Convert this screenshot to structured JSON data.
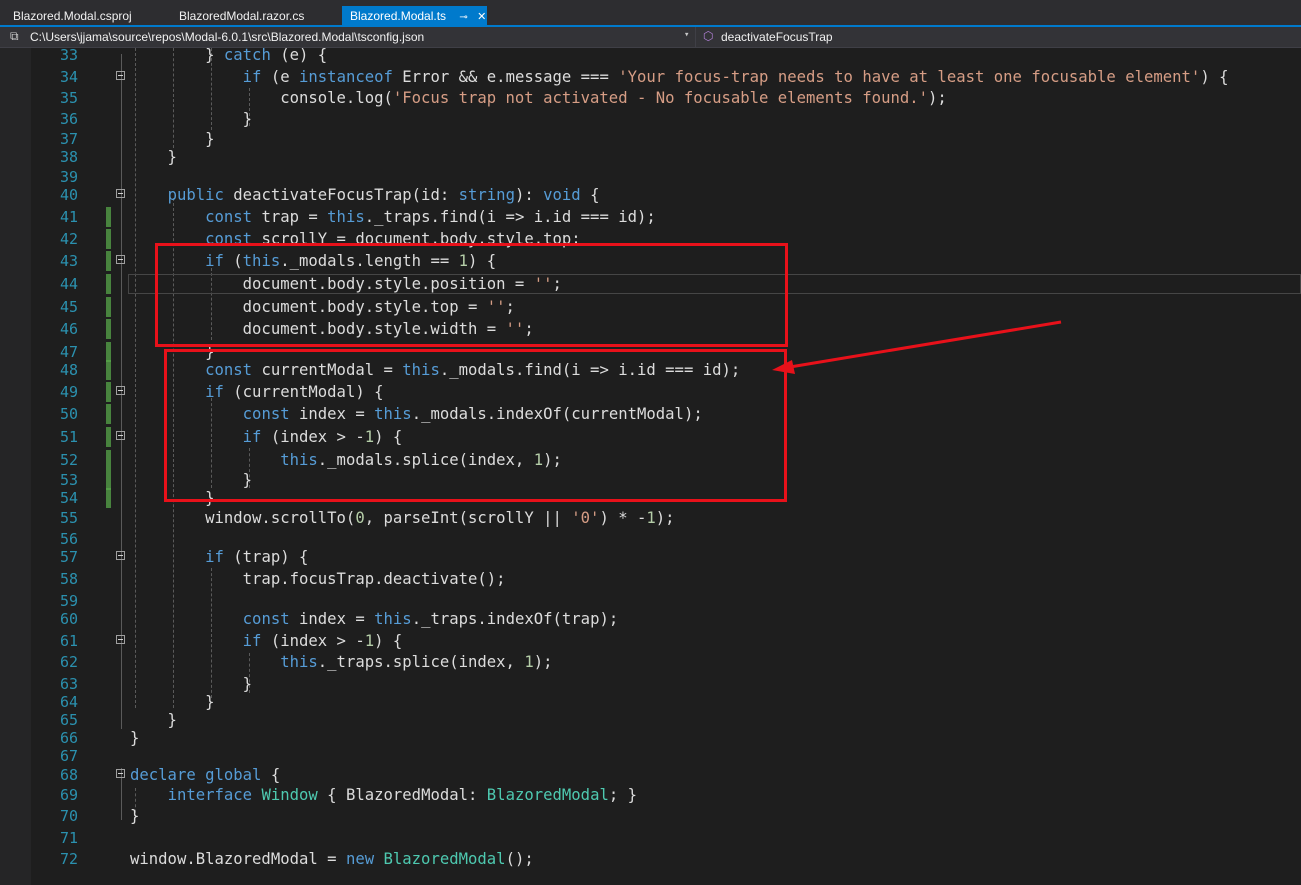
{
  "tabs": [
    {
      "label": "Blazored.Modal.csproj"
    },
    {
      "label": "BlazoredModal.razor.cs"
    },
    {
      "label": "Blazored.Modal.ts",
      "active": true
    }
  ],
  "nav": {
    "path": "C:\\Users\\jjama\\source\\repos\\Modal-6.0.1\\src\\Blazored.Modal\\tsconfig.json",
    "member": "deactivateFocusTrap"
  },
  "lines": [
    {
      "n": "33",
      "html": "        } <span class=\"k\">catch</span> (e) {"
    },
    {
      "n": "34",
      "html": "            <span class=\"k\">if</span> (e <span class=\"k\">instanceof</span> Error &amp;&amp; e.message === <span class=\"s\">'Your focus-trap needs to have at least one focusable element'</span>) {"
    },
    {
      "n": "35",
      "html": "                console.log(<span class=\"s\">'Focus trap not activated - No focusable elements found.'</span>);"
    },
    {
      "n": "36",
      "html": "            }"
    },
    {
      "n": "37",
      "html": "        }"
    },
    {
      "n": "38",
      "html": "    }"
    },
    {
      "n": "39",
      "html": ""
    },
    {
      "n": "40",
      "html": "    <span class=\"k\">public</span> deactivateFocusTrap(id: <span class=\"k\">string</span>): <span class=\"k\">void</span> {"
    },
    {
      "n": "41",
      "html": "        <span class=\"k\">const</span> trap = <span class=\"k\">this</span>._traps.find(i =&gt; i.id === id);"
    },
    {
      "n": "42",
      "html": "        <span class=\"k\">const</span> scrollY = document.body.style.top;"
    },
    {
      "n": "43",
      "html": "        <span class=\"k\">if</span> (<span class=\"k\">this</span>._modals.length == <span class=\"n\">1</span>) {"
    },
    {
      "n": "44",
      "html": "            document.body.style.position = <span class=\"s\">''</span>;"
    },
    {
      "n": "45",
      "html": "            document.body.style.top = <span class=\"s\">''</span>;"
    },
    {
      "n": "46",
      "html": "            document.body.style.width = <span class=\"s\">''</span>;"
    },
    {
      "n": "47",
      "html": "        }"
    },
    {
      "n": "48",
      "html": "        <span class=\"k\">const</span> currentModal = <span class=\"k\">this</span>._modals.find(i =&gt; i.id === id);"
    },
    {
      "n": "49",
      "html": "        <span class=\"k\">if</span> (currentModal) {"
    },
    {
      "n": "50",
      "html": "            <span class=\"k\">const</span> index = <span class=\"k\">this</span>._modals.indexOf(currentModal);"
    },
    {
      "n": "51",
      "html": "            <span class=\"k\">if</span> (index &gt; -<span class=\"n\">1</span>) {"
    },
    {
      "n": "52",
      "html": "                <span class=\"k\">this</span>._modals.splice(index, <span class=\"n\">1</span>);"
    },
    {
      "n": "53",
      "html": "            }"
    },
    {
      "n": "54",
      "html": "        }"
    },
    {
      "n": "55",
      "html": "        window.scrollTo(<span class=\"n\">0</span>, parseInt(scrollY || <span class=\"s\">'0'</span>) * -<span class=\"n\">1</span>);"
    },
    {
      "n": "56",
      "html": ""
    },
    {
      "n": "57",
      "html": "        <span class=\"k\">if</span> (trap) {"
    },
    {
      "n": "58",
      "html": "            trap.focusTrap.deactivate();"
    },
    {
      "n": "59",
      "html": ""
    },
    {
      "n": "60",
      "html": "            <span class=\"k\">const</span> index = <span class=\"k\">this</span>._traps.indexOf(trap);"
    },
    {
      "n": "61",
      "html": "            <span class=\"k\">if</span> (index &gt; -<span class=\"n\">1</span>) {"
    },
    {
      "n": "62",
      "html": "                <span class=\"k\">this</span>._traps.splice(index, <span class=\"n\">1</span>);"
    },
    {
      "n": "63",
      "html": "            }"
    },
    {
      "n": "64",
      "html": "        }"
    },
    {
      "n": "65",
      "html": "    }"
    },
    {
      "n": "66",
      "html": "}"
    },
    {
      "n": "67",
      "html": ""
    },
    {
      "n": "68",
      "html": "<span class=\"k\">declare</span> <span class=\"k\">global</span> {"
    },
    {
      "n": "69",
      "html": "    <span class=\"k\">interface</span> <span class=\"t\">Window</span> { BlazoredModal: <span class=\"t\">BlazoredModal</span>; }"
    },
    {
      "n": "70",
      "html": "}"
    },
    {
      "n": "71",
      "html": ""
    },
    {
      "n": "72",
      "html": "window.BlazoredModal = <span class=\"k\">new</span> <span class=\"t\">BlazoredModal</span>();"
    }
  ],
  "fold_lines": [
    "34",
    "40",
    "43",
    "49",
    "51",
    "57",
    "61",
    "68"
  ],
  "changed_lines": [
    "41",
    "42",
    "43",
    "44",
    "45",
    "46",
    "47",
    "48",
    "49",
    "50",
    "51",
    "52",
    "53",
    "54"
  ],
  "current_line": "44",
  "colors": {
    "keyword": "#569cd6",
    "string": "#d69d85",
    "type": "#4ec9b0",
    "line_number": "#2b91af",
    "annotation": "#e8111a"
  }
}
